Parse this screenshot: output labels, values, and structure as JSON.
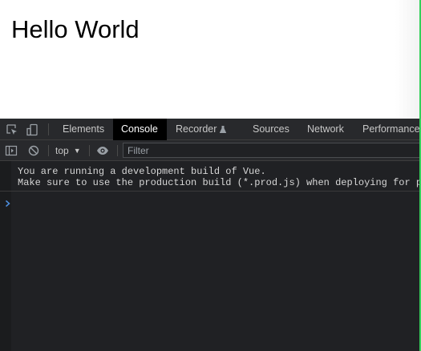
{
  "page": {
    "heading": "Hello World"
  },
  "devtools": {
    "tabs": [
      {
        "label": "Elements",
        "active": false
      },
      {
        "label": "Console",
        "active": true
      },
      {
        "label": "Recorder",
        "active": false
      },
      {
        "label": "Sources",
        "active": false
      },
      {
        "label": "Network",
        "active": false
      },
      {
        "label": "Performance",
        "active": false
      }
    ],
    "toolbar_icons": [
      "inspect-element-icon",
      "device-toolbar-icon"
    ],
    "console_toolbar": {
      "context": "top",
      "filter_placeholder": "Filter",
      "filter_value": "",
      "icons": [
        "sidebar-toggle-icon",
        "clear-console-icon",
        "eye-icon"
      ]
    },
    "messages": [
      "You are running a development build of Vue.",
      "Make sure to use the production build (*.prod.js) when deploying for production."
    ]
  },
  "colors": {
    "devtools_bg": "#202124",
    "toolbar_bg": "#28292c",
    "active_tab_bg": "#000000",
    "edge_accent": "#33d15a",
    "prompt_accent": "#4d8fe0"
  }
}
